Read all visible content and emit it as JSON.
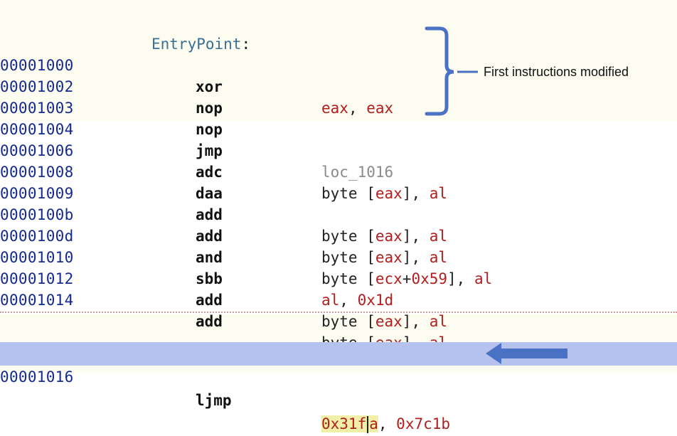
{
  "labels": {
    "entry": "EntryPoint",
    "loc": "loc_1016",
    "colon": ":"
  },
  "rows": [
    {
      "addr": "00001000",
      "mnem": "xor",
      "op1": "eax",
      "sep": ", ",
      "op2": "eax"
    },
    {
      "addr": "00001002",
      "mnem": "nop"
    },
    {
      "addr": "00001003",
      "mnem": "nop"
    },
    {
      "addr": "00001004",
      "mnem": "jmp",
      "target": "loc_1016"
    },
    {
      "addr": "00001006",
      "mnem": "adc",
      "pre": "byte [",
      "reg": "eax",
      "post": "], ",
      "reg2": "al"
    },
    {
      "addr": "00001008",
      "mnem": "daa"
    },
    {
      "addr": "00001009",
      "mnem": "add",
      "pre": "byte [",
      "reg": "eax",
      "post": "], ",
      "reg2": "al"
    },
    {
      "addr": "0000100b",
      "mnem": "add",
      "pre": "byte [",
      "reg": "eax",
      "post": "], ",
      "reg2": "al"
    },
    {
      "addr": "0000100d",
      "mnem": "and",
      "pre": "byte [",
      "reg": "ecx",
      "plus": "+",
      "num": "0x59",
      "post": "], ",
      "reg2": "al"
    },
    {
      "addr": "00001010",
      "mnem": "sbb",
      "reg": "al",
      "sep": ", ",
      "num": "0x1d"
    },
    {
      "addr": "00001012",
      "mnem": "add",
      "pre": "byte [",
      "reg": "eax",
      "post": "], ",
      "reg2": "al"
    },
    {
      "addr": "00001014",
      "mnem": "add",
      "pre": "byte [",
      "reg": "eax",
      "post": "], ",
      "reg2": "al"
    }
  ],
  "selected": {
    "addr": "00001016",
    "mnem": "ljmp",
    "w1a": "0x31f",
    "w1b": "a",
    "sep": ", ",
    "w2": "0x7c1b"
  },
  "annotation": "First instructions modified",
  "colors": {
    "address": "#142a8e",
    "register": "#b21e1e",
    "selection": "#b6c2ee",
    "annotation_blue": "#4a72c4"
  }
}
